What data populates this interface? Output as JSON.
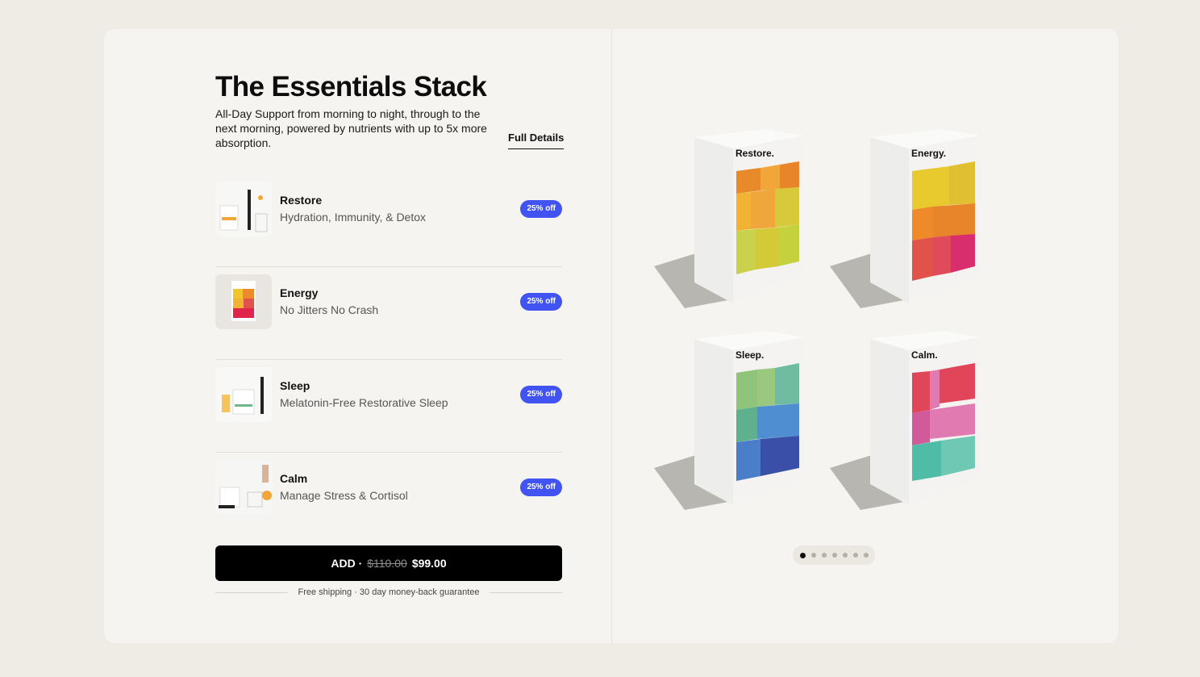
{
  "header": {
    "title": "The Essentials Stack",
    "description": "All-Day Support from morning to night, through to the next morning, powered by nutrients with up to 5x more absorption.",
    "full_details_label": "Full Details"
  },
  "products": [
    {
      "name": "Restore",
      "subtitle": "Hydration, Immunity, & Detox",
      "badge": "25% off",
      "box_label": "Restore.",
      "colors": [
        "#e8892a",
        "#f2b233",
        "#d8c93a",
        "#c9d24a"
      ]
    },
    {
      "name": "Energy",
      "subtitle": "No Jitters No Crash",
      "badge": "25% off",
      "box_label": "Energy.",
      "colors": [
        "#e8c92e",
        "#e8842a",
        "#e0524a",
        "#d82e6e"
      ]
    },
    {
      "name": "Sleep",
      "subtitle": "Melatonin-Free Restorative Sleep",
      "badge": "25% off",
      "box_label": "Sleep.",
      "colors": [
        "#8fc47a",
        "#5fb08e",
        "#4f8ed0",
        "#3a4fa8"
      ]
    },
    {
      "name": "Calm",
      "subtitle": "Manage Stress & Cortisol",
      "badge": "25% off",
      "box_label": "Calm.",
      "colors": [
        "#e0455a",
        "#e07ab0",
        "#d05a9a",
        "#4fbca8"
      ]
    }
  ],
  "cta": {
    "prefix": "ADD ·",
    "old_price": "$110.00",
    "price": "$99.00"
  },
  "guarantee": "Free shipping · 30 day money-back guarantee",
  "carousel": {
    "count": 7,
    "active": 0
  },
  "colors": {
    "accent": "#4153f0",
    "button": "#000000",
    "background": "#f6f4f0"
  }
}
